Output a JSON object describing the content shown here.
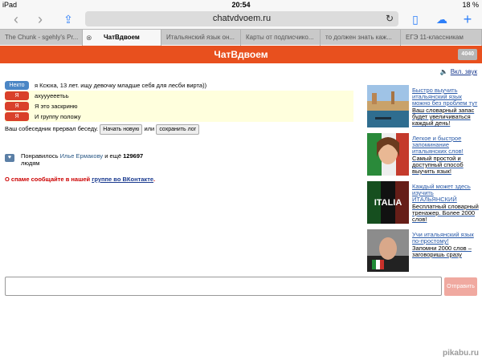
{
  "status_bar": {
    "device": "iPad",
    "time": "20:54",
    "battery": "18 %"
  },
  "browser": {
    "url": "chatvdvoem.ru",
    "tabs": [
      "The Chunk - sgehly's Pr...",
      "ЧатВдвоем",
      "Итальянский язык он...",
      "Карты от подписчико...",
      "то должен знать каж...",
      "ЕГЭ 11-классникам"
    ]
  },
  "site": {
    "title": "ЧатВдвоем",
    "online_count": "4040",
    "sound_label": "Вкл. звук"
  },
  "messages": [
    {
      "who": "Некто",
      "text": "я Ксюха, 13 лет. ищу девочку младше себя для лесби вирта))",
      "kind": "stranger"
    },
    {
      "who": "Я",
      "text": "ахуууееетьь",
      "kind": "me"
    },
    {
      "who": "Я",
      "text": "Я это заскриню",
      "kind": "me"
    },
    {
      "who": "Я",
      "text": "И группу положу",
      "kind": "me"
    }
  ],
  "ended": {
    "text": "Ваш собеседник прервал беседу.",
    "new_btn": "Начать новую",
    "or": "или",
    "save_btn": "сохранить лог"
  },
  "like": {
    "prefix": "Понравилось",
    "name": "Илье Ермакову",
    "mid": "и ещё",
    "count": "129697",
    "suffix": "людям"
  },
  "spam": {
    "text": "О спаме сообщайте в нашей",
    "link": "группе во ВКонтакте",
    "end": "."
  },
  "ads": [
    {
      "title": "Быстро выучить итальянский язык можно без проблем тут",
      "body": "Ваш словарный запас будет увеличиваться каждый день!"
    },
    {
      "title": "Легкое и быстрое запоминание итальянских слов!",
      "body": "Самый простой и доступный способ выучить язык!"
    },
    {
      "title": "Каждый может здесь изучить ИТАЛЬЯНСКИЙ",
      "body": "Бесплатный словарный тренажер. Более 2000 слов!"
    },
    {
      "title": "Учи итальянский язык по-простому!",
      "body": "Запомни 2000 слов – заговоришь сразу"
    }
  ],
  "ad_image_text": "ITALIA",
  "composer": {
    "value": "",
    "send_label": "Отправить"
  },
  "watermark": "pikabu.ru"
}
